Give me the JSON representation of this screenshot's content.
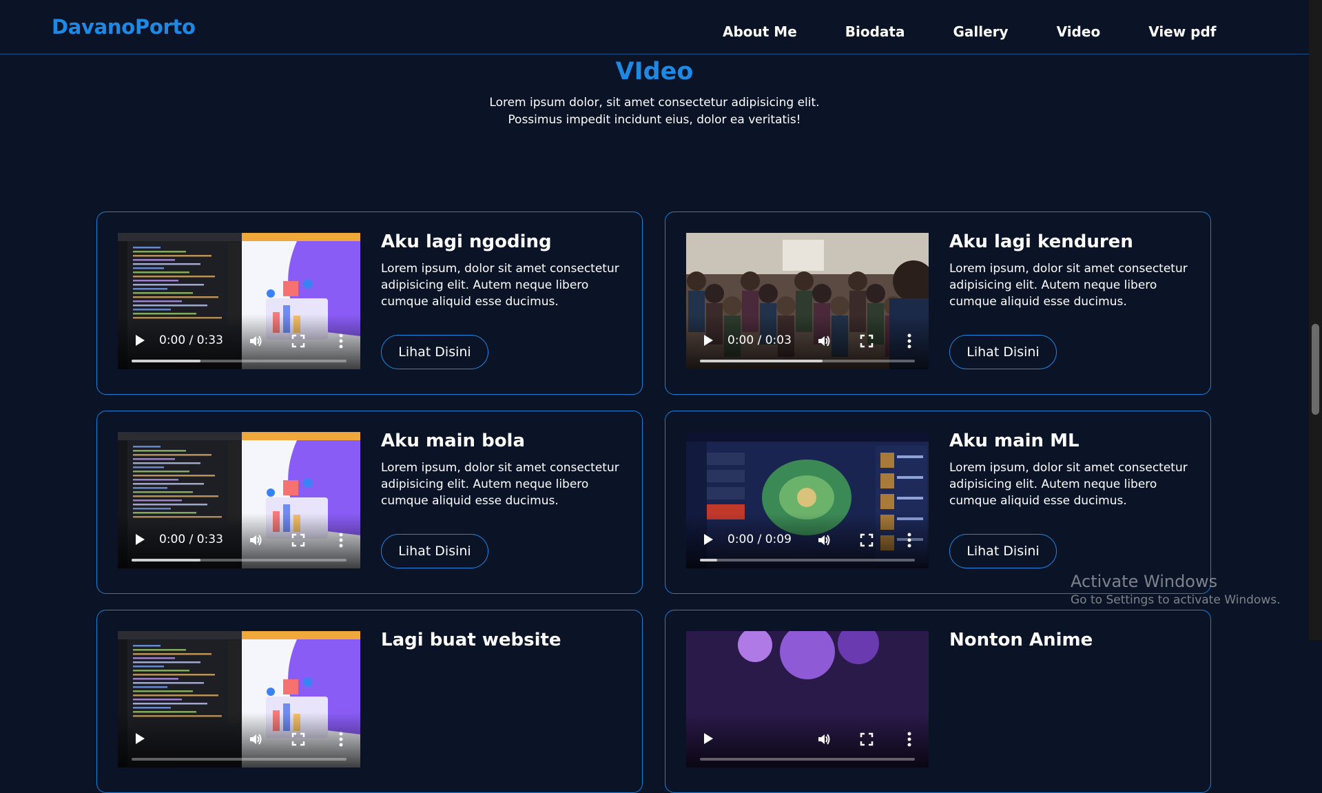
{
  "nav": {
    "logo": "DavanoPorto",
    "links": [
      "About Me",
      "Biodata",
      "Gallery",
      "Video",
      "View pdf"
    ]
  },
  "section": {
    "title": "VIdeo",
    "description": "Lorem ipsum dolor, sit amet consectetur adipisicing elit. Possimus impedit incidunt eius, dolor ea veritatis!"
  },
  "cards": [
    {
      "title": "Aku lagi ngoding",
      "text": "Lorem ipsum, dolor sit amet consectetur adipisicing elit. Autem neque libero cumque aliquid esse ducimus.",
      "button": "Lihat Disini",
      "time": "0:00 / 0:33",
      "progress_fraction": 0.32,
      "scene": "coding"
    },
    {
      "title": "Aku lagi kenduren",
      "text": "Lorem ipsum, dolor sit amet consectetur adipisicing elit. Autem neque libero cumque aliquid esse ducimus.",
      "button": "Lihat Disini",
      "time": "0:00 / 0:03",
      "progress_fraction": 0.57,
      "scene": "crowd"
    },
    {
      "title": "Aku main bola",
      "text": "Lorem ipsum, dolor sit amet consectetur adipisicing elit. Autem neque libero cumque aliquid esse ducimus.",
      "button": "Lihat Disini",
      "time": "0:00 / 0:33",
      "progress_fraction": 0.32,
      "scene": "coding"
    },
    {
      "title": "Aku main ML",
      "text": "Lorem ipsum, dolor sit amet consectetur adipisicing elit. Autem neque libero cumque aliquid esse ducimus.",
      "button": "Lihat Disini",
      "time": "0:00 / 0:09",
      "progress_fraction": 0.08,
      "scene": "game"
    },
    {
      "title": "Lagi buat website",
      "text": "",
      "button": "",
      "time": "",
      "progress_fraction": 0,
      "scene": "coding"
    },
    {
      "title": "Nonton Anime",
      "text": "",
      "button": "",
      "time": "",
      "progress_fraction": 0,
      "scene": "anime"
    }
  ],
  "watermark": {
    "title": "Activate Windows",
    "subtitle": "Go to Settings to activate Windows."
  },
  "colors": {
    "background": "#0b1426",
    "accent": "#1e88e5",
    "card_border": "#1e7fd6"
  }
}
